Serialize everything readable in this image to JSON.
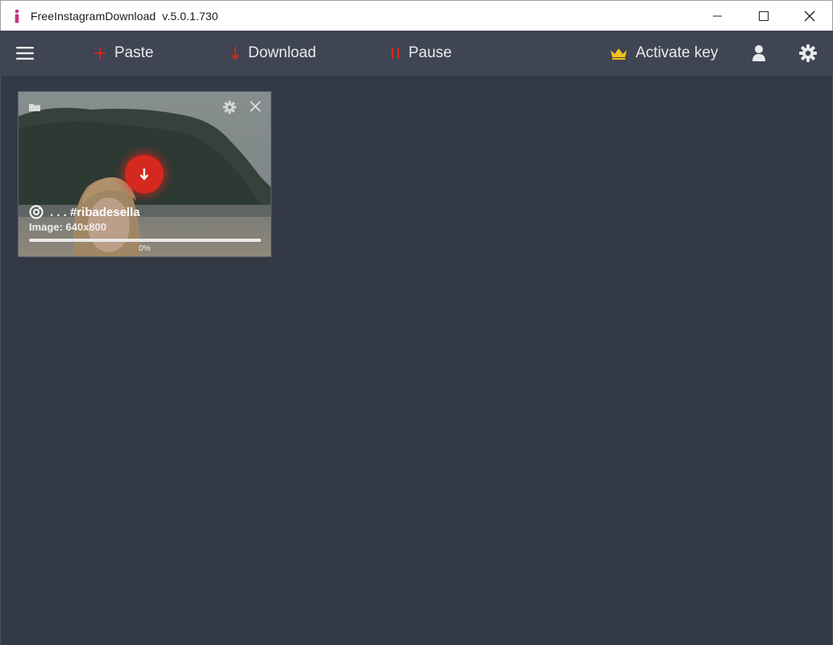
{
  "window": {
    "app_name": "FreeInstagramDownload",
    "version": "v.5.0.1.730"
  },
  "toolbar": {
    "paste_label": "Paste",
    "download_label": "Download",
    "pause_label": "Pause",
    "activate_label": "Activate key"
  },
  "colors": {
    "accent_red": "#d5281e",
    "crown_gold": "#f2c21b",
    "toolbar_bg": "#3f4552",
    "main_bg": "#343a45"
  },
  "downloads": [
    {
      "title": ". . . #ribadesella",
      "subtitle": "Image: 640x800",
      "progress": 0,
      "progress_label": "0%"
    }
  ]
}
